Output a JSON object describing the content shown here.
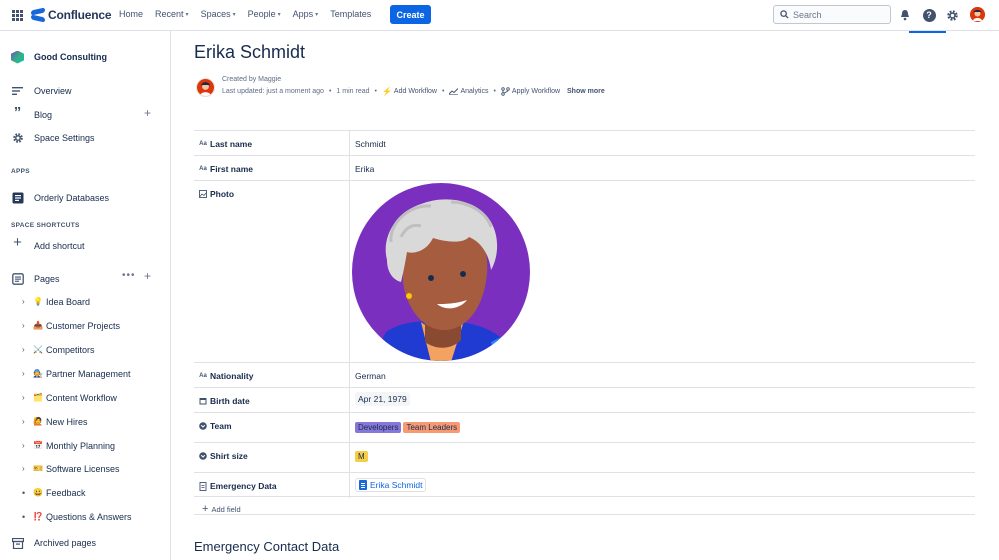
{
  "app": {
    "brand": "Confluence",
    "accent": "#0c66e4"
  },
  "topnav": {
    "items": [
      {
        "label": "Home",
        "dropdown": false
      },
      {
        "label": "Recent",
        "dropdown": true
      },
      {
        "label": "Spaces",
        "dropdown": true
      },
      {
        "label": "People",
        "dropdown": true
      },
      {
        "label": "Apps",
        "dropdown": true
      },
      {
        "label": "Templates",
        "dropdown": false
      }
    ],
    "create_label": "Create",
    "search_placeholder": "Search"
  },
  "sidebar": {
    "space_name": "Good Consulting",
    "overview": "Overview",
    "blog": "Blog",
    "space_settings": "Space Settings",
    "apps_heading": "APPS",
    "orderly": "Orderly Databases",
    "shortcuts_heading": "SPACE SHORTCUTS",
    "add_shortcut": "Add shortcut",
    "pages": "Pages",
    "tree": [
      {
        "emoji": "💡",
        "label": "Idea Board",
        "chevron": true
      },
      {
        "emoji": "📥",
        "label": "Customer Projects",
        "chevron": true
      },
      {
        "emoji": "⚔️",
        "label": "Competitors",
        "chevron": true
      },
      {
        "emoji": "🧑‍🔧",
        "label": "Partner Management",
        "chevron": true
      },
      {
        "emoji": "🗂️",
        "label": "Content Workflow",
        "chevron": true
      },
      {
        "emoji": "🙋",
        "label": "New Hires",
        "chevron": true
      },
      {
        "emoji": "📅",
        "label": "Monthly Planning",
        "chevron": true
      },
      {
        "emoji": "🎫",
        "label": "Software Licenses",
        "chevron": true
      },
      {
        "emoji": "😀",
        "label": "Feedback",
        "chevron": false
      },
      {
        "emoji": "⁉️",
        "label": "Questions & Answers",
        "chevron": false
      }
    ],
    "archived": "Archived pages"
  },
  "page": {
    "title": "Erika Schmidt",
    "created_by": "Created by Maggie",
    "last_updated": "Last updated: just a moment ago",
    "read_time": "1 min read",
    "add_workflow": "Add Workflow",
    "analytics": "Analytics",
    "apply_workflow": "Apply Workflow",
    "show_more": "Show more"
  },
  "properties": {
    "last_name": {
      "key": "Last name",
      "value": "Schmidt"
    },
    "first_name": {
      "key": "First name",
      "value": "Erika"
    },
    "photo": {
      "key": "Photo"
    },
    "nationality": {
      "key": "Nationality",
      "value": "German"
    },
    "birth_date": {
      "key": "Birth date",
      "value": "Apr 21, 1979"
    },
    "team": {
      "key": "Team",
      "tags": [
        "Developers",
        "Team Leaders"
      ]
    },
    "shirt_size": {
      "key": "Shirt size",
      "value": "M"
    },
    "emergency": {
      "key": "Emergency Data",
      "link": "Erika Schmidt"
    },
    "add_field": "Add field"
  },
  "section_heading": "Emergency Contact Data"
}
